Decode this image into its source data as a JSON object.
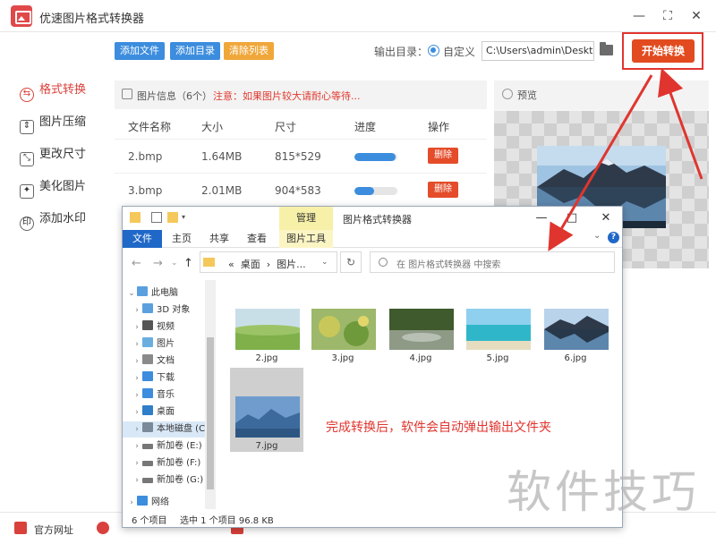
{
  "app": {
    "title": "优速图片格式转换器",
    "win_min": "—",
    "win_max": "⛶",
    "win_close": "✕"
  },
  "sidebar": {
    "items": [
      {
        "label": "格式转换",
        "icon": "swap-icon"
      },
      {
        "label": "图片压缩",
        "icon": "compress-icon"
      },
      {
        "label": "更改尺寸",
        "icon": "resize-icon"
      },
      {
        "label": "美化图片",
        "icon": "beautify-icon"
      },
      {
        "label": "添加水印",
        "icon": "watermark-icon"
      }
    ]
  },
  "toolbar": {
    "add_file": "添加文件",
    "add_dir": "添加目录",
    "clear_list": "清除列表",
    "output_label": "输出目录：",
    "custom_label": "自定义",
    "output_path": "C:\\Users\\admin\\Deskto",
    "start_label": "开始转换"
  },
  "info": {
    "title": "图片信息（6个）",
    "warning": "注意：如果图片较大请耐心等待..."
  },
  "table": {
    "headers": [
      "文件名称",
      "大小",
      "尺寸",
      "进度",
      "操作"
    ],
    "rows": [
      {
        "name": "2.bmp",
        "size": "1.64MB",
        "dims": "815*529",
        "progress": 0.95,
        "action": "删除"
      },
      {
        "name": "3.bmp",
        "size": "2.01MB",
        "dims": "904*583",
        "progress": 0.45,
        "action": "删除"
      }
    ]
  },
  "preview": {
    "title": "预览"
  },
  "bottom": {
    "official_site": "官方网址"
  },
  "explorer": {
    "manage_tab": "管理",
    "window_title": "图片格式转换器",
    "ctrl_min": "—",
    "ctrl_max": "□",
    "ctrl_close": "✕",
    "ribbon_tabs": [
      "文件",
      "主页",
      "共享",
      "查看",
      "图片工具"
    ],
    "address": {
      "prefix": "«",
      "part1": "桌面",
      "sep": "›",
      "part2": "图片..."
    },
    "search_placeholder": "在 图片格式转换器 中搜索",
    "tree": [
      {
        "label": "此电脑",
        "expanded": true
      },
      {
        "label": "3D 对象"
      },
      {
        "label": "视频"
      },
      {
        "label": "图片"
      },
      {
        "label": "文档"
      },
      {
        "label": "下载"
      },
      {
        "label": "音乐"
      },
      {
        "label": "桌面"
      },
      {
        "label": "本地磁盘 (C"
      },
      {
        "label": "新加卷 (E:)"
      },
      {
        "label": "新加卷 (F:)"
      },
      {
        "label": "新加卷 (G:)"
      },
      {
        "label": "网络"
      }
    ],
    "files": [
      "2.jpg",
      "3.jpg",
      "4.jpg",
      "5.jpg",
      "6.jpg",
      "7.jpg"
    ],
    "status_count": "6 个项目",
    "status_sel": "选中 1 个项目  96.8 KB"
  },
  "annotation": "完成转换后，软件会自动弹出输出文件夹",
  "watermark": "软件技巧",
  "colors": {
    "accent_red": "#e24b1f",
    "accent_blue": "#3c8dde",
    "annotation_red": "#e0352f"
  }
}
